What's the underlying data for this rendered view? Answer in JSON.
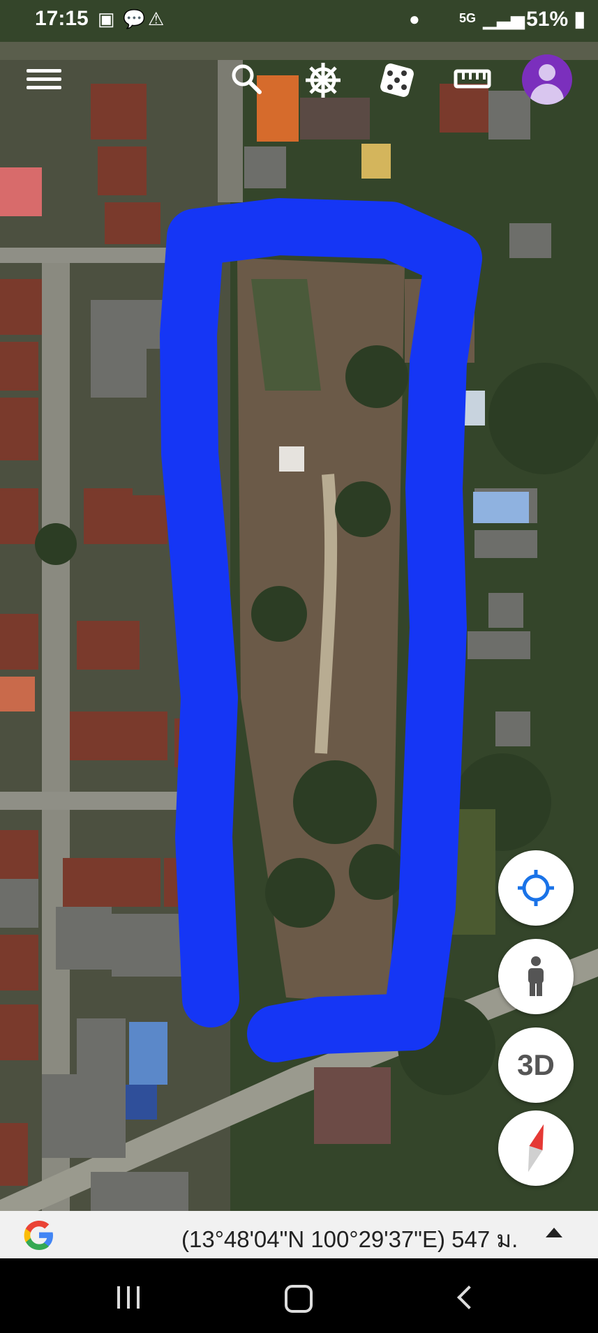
{
  "status_bar": {
    "time": "17:15",
    "network": "5G",
    "battery": "51%"
  },
  "toolbar": {
    "icons": [
      "menu-icon",
      "search-icon",
      "voyager-icon",
      "dice-icon",
      "ruler-icon",
      "account-icon"
    ]
  },
  "map": {
    "type": "satellite",
    "annotation_color": "#1536f5"
  },
  "fab": {
    "my_location": "my-location-icon",
    "street_view": "pegman-icon",
    "three_d_label": "3D",
    "compass": "compass-icon"
  },
  "info_bar": {
    "coordinates": "(13°48'04\"N 100°29'37\"E) 547 ม."
  },
  "nav_bar": {
    "icons": [
      "recents-icon",
      "home-icon",
      "back-icon"
    ]
  }
}
